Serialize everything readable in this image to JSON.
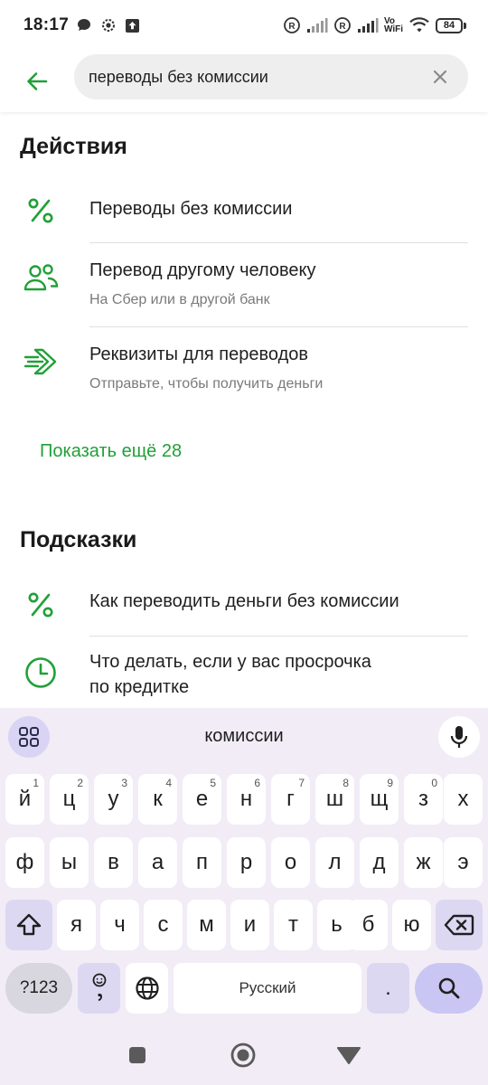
{
  "status": {
    "time": "18:17",
    "battery": "84",
    "vowifi_top": "Vo",
    "vowifi_bottom": "WiFi"
  },
  "search": {
    "query": "переводы без комиссии"
  },
  "actions": {
    "title": "Действия",
    "items": [
      {
        "icon": "percent-icon",
        "title": "Переводы без комиссии",
        "subtitle": ""
      },
      {
        "icon": "people-icon",
        "title": "Перевод другому человеку",
        "subtitle": "На Сбер или в другой банк"
      },
      {
        "icon": "send-arrow-icon",
        "title": "Реквизиты для переводов",
        "subtitle": "Отправьте, чтобы получить деньги"
      }
    ],
    "show_more": "Показать ещё 28"
  },
  "hints": {
    "title": "Подсказки",
    "items": [
      {
        "icon": "percent-icon",
        "title": "Как переводить деньги без комиссии"
      },
      {
        "icon": "clock-icon",
        "title": "Что делать, если у вас просрочка",
        "title_line2": "по кредитке"
      }
    ]
  },
  "keyboard": {
    "suggestion": "комиссии",
    "row1": [
      {
        "k": "й",
        "h": "1"
      },
      {
        "k": "ц",
        "h": "2"
      },
      {
        "k": "у",
        "h": "3"
      },
      {
        "k": "к",
        "h": "4"
      },
      {
        "k": "е",
        "h": "5"
      },
      {
        "k": "н",
        "h": "6"
      },
      {
        "k": "г",
        "h": "7"
      },
      {
        "k": "ш",
        "h": "8"
      },
      {
        "k": "щ",
        "h": "9"
      },
      {
        "k": "з",
        "h": "0"
      },
      {
        "k": "х",
        "h": ""
      }
    ],
    "row2": [
      "ф",
      "ы",
      "в",
      "а",
      "п",
      "р",
      "о",
      "л",
      "д",
      "ж",
      "э"
    ],
    "row3": [
      "я",
      "ч",
      "с",
      "м",
      "и",
      "т",
      "ь",
      "б",
      "ю"
    ],
    "symbols_label": "?123",
    "space_label": "Русский",
    "period_label": "."
  },
  "colors": {
    "accent_green": "#21a038",
    "keyboard_bg": "#f2ecf6"
  }
}
